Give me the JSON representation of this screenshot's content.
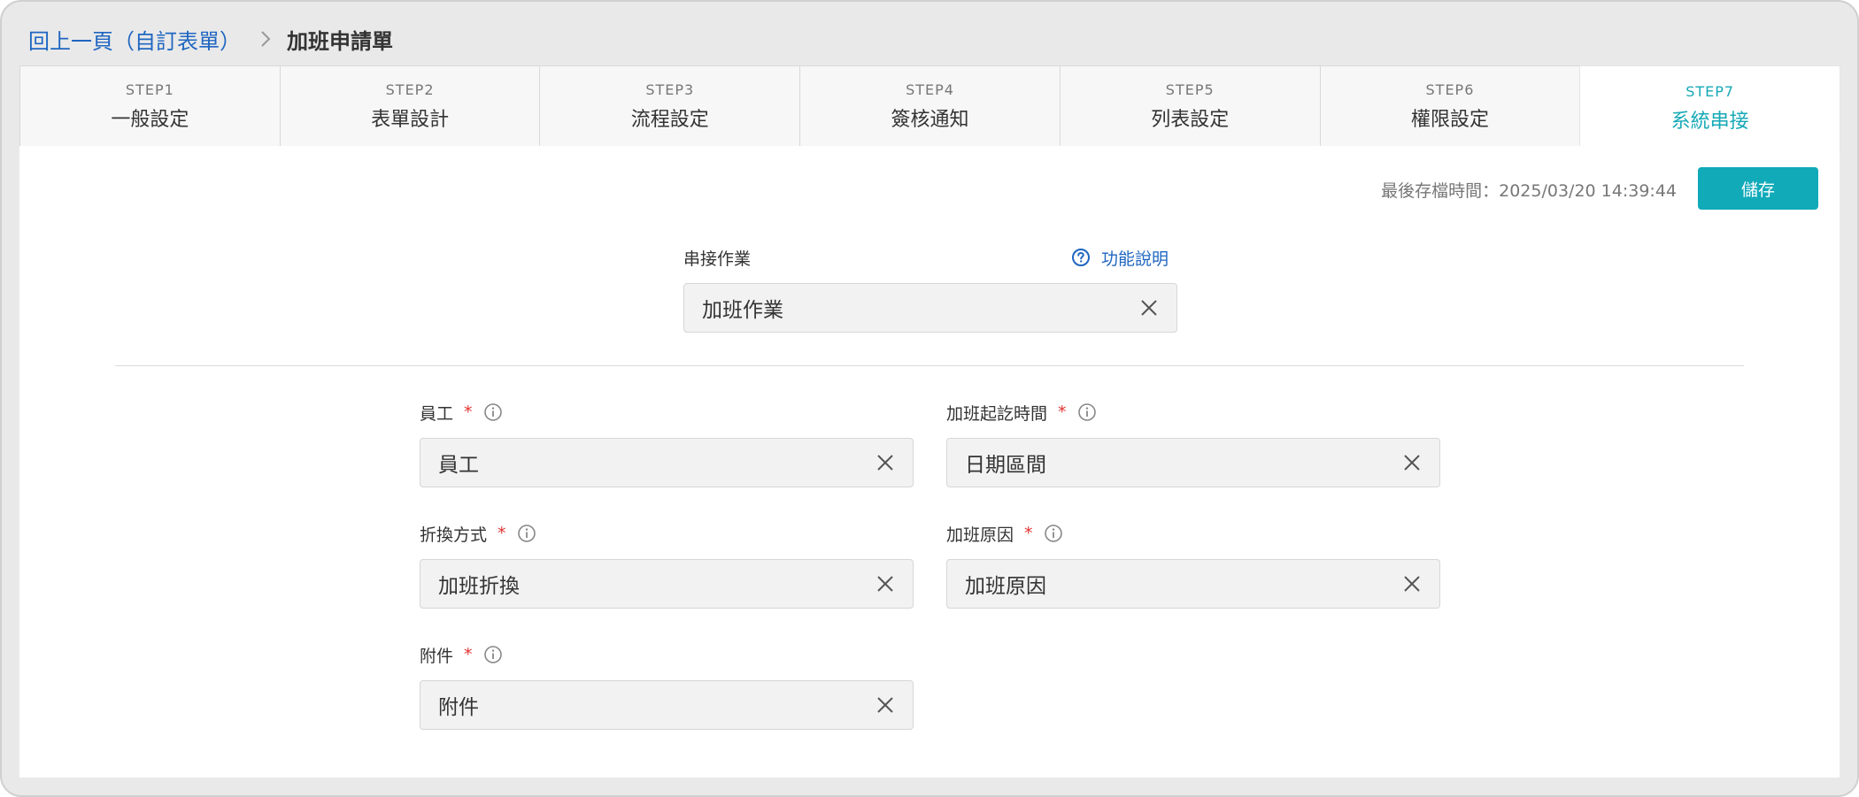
{
  "breadcrumb": {
    "back_label": "回上一頁（自訂表單）",
    "current": "加班申請單"
  },
  "steps": [
    {
      "no": "STEP1",
      "name": "一般設定"
    },
    {
      "no": "STEP2",
      "name": "表單設計"
    },
    {
      "no": "STEP3",
      "name": "流程設定"
    },
    {
      "no": "STEP4",
      "name": "簽核通知"
    },
    {
      "no": "STEP5",
      "name": "列表設定"
    },
    {
      "no": "STEP6",
      "name": "權限設定"
    },
    {
      "no": "STEP7",
      "name": "系統串接"
    }
  ],
  "active_step": "STEP7",
  "toolbar": {
    "saved_time": "最後存檔時間：2025/03/20 14:39:44",
    "save_label": "儲存"
  },
  "integration": {
    "label": "串接作業",
    "help_label": "功能說明",
    "value": "加班作業"
  },
  "fields": {
    "employee": {
      "label": "員工",
      "required": "*",
      "value": "員工"
    },
    "overtime_period": {
      "label": "加班起訖時間",
      "required": "*",
      "value": "日期區間"
    },
    "conversion": {
      "label": "折換方式",
      "required": "*",
      "value": "加班折換"
    },
    "reason": {
      "label": "加班原因",
      "required": "*",
      "value": "加班原因"
    },
    "attachment": {
      "label": "附件",
      "required": "*",
      "value": "附件"
    }
  },
  "colors": {
    "accent": "#10aab9",
    "link": "#1f66c1",
    "required": "#e23434"
  },
  "icons": {
    "breadcrumb_separator": "chevron-right-icon",
    "help": "question-circle-icon",
    "info": "info-circle-icon",
    "clear": "close-icon"
  }
}
